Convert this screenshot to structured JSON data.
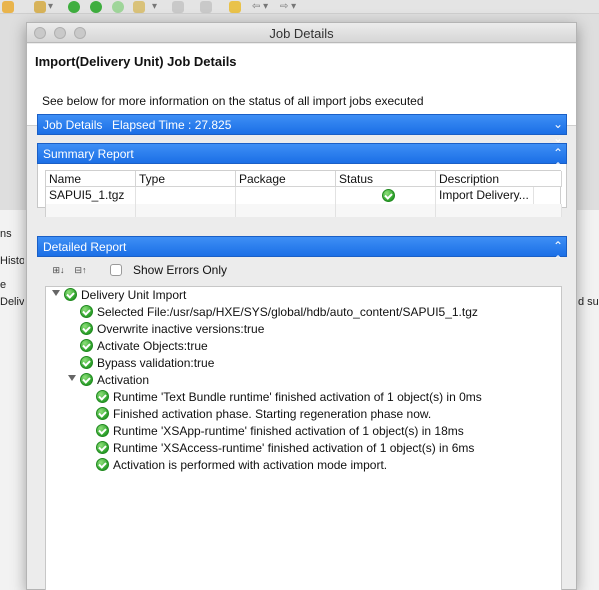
{
  "ide": {
    "left_fragments": [
      "ns",
      "Histo",
      "e",
      "Delive"
    ],
    "right_fragment": "d su"
  },
  "dialog": {
    "window_title": "Job Details",
    "header_title": "Import(Delivery Unit) Job Details",
    "header_description": "See below for more information on the status of all import jobs executed"
  },
  "job_details_bar": {
    "label": "Job Details",
    "elapsed_label": "Elapsed Time : 27.825"
  },
  "summary": {
    "title": "Summary Report",
    "columns": [
      "Name",
      "Type",
      "Package",
      "Status",
      "Description"
    ],
    "rows": [
      {
        "name": "SAPUI5_1.tgz",
        "type": "",
        "package": "",
        "status": "success",
        "description": "Import Delivery..."
      }
    ]
  },
  "detailed": {
    "title": "Detailed Report",
    "show_errors_label": "Show Errors Only",
    "tree": {
      "root": "Delivery Unit Import",
      "items": [
        "Selected File:/usr/sap/HXE/SYS/global/hdb/auto_content/SAPUI5_1.tgz",
        "Overwrite inactive versions:true",
        "Activate Objects:true",
        "Bypass validation:true"
      ],
      "activation": {
        "label": "Activation",
        "children": [
          "Runtime 'Text Bundle runtime' finished activation of 1 object(s) in 0ms",
          "Finished activation phase. Starting regeneration phase now.",
          "Runtime 'XSApp-runtime' finished activation of 1 object(s) in 18ms",
          "Runtime 'XSAccess-runtime' finished activation of 1 object(s) in 6ms",
          "Activation is performed with activation mode import."
        ]
      }
    }
  },
  "colors": {
    "section_blue": "#1b6fe6",
    "success_green": "#2ba02a"
  }
}
